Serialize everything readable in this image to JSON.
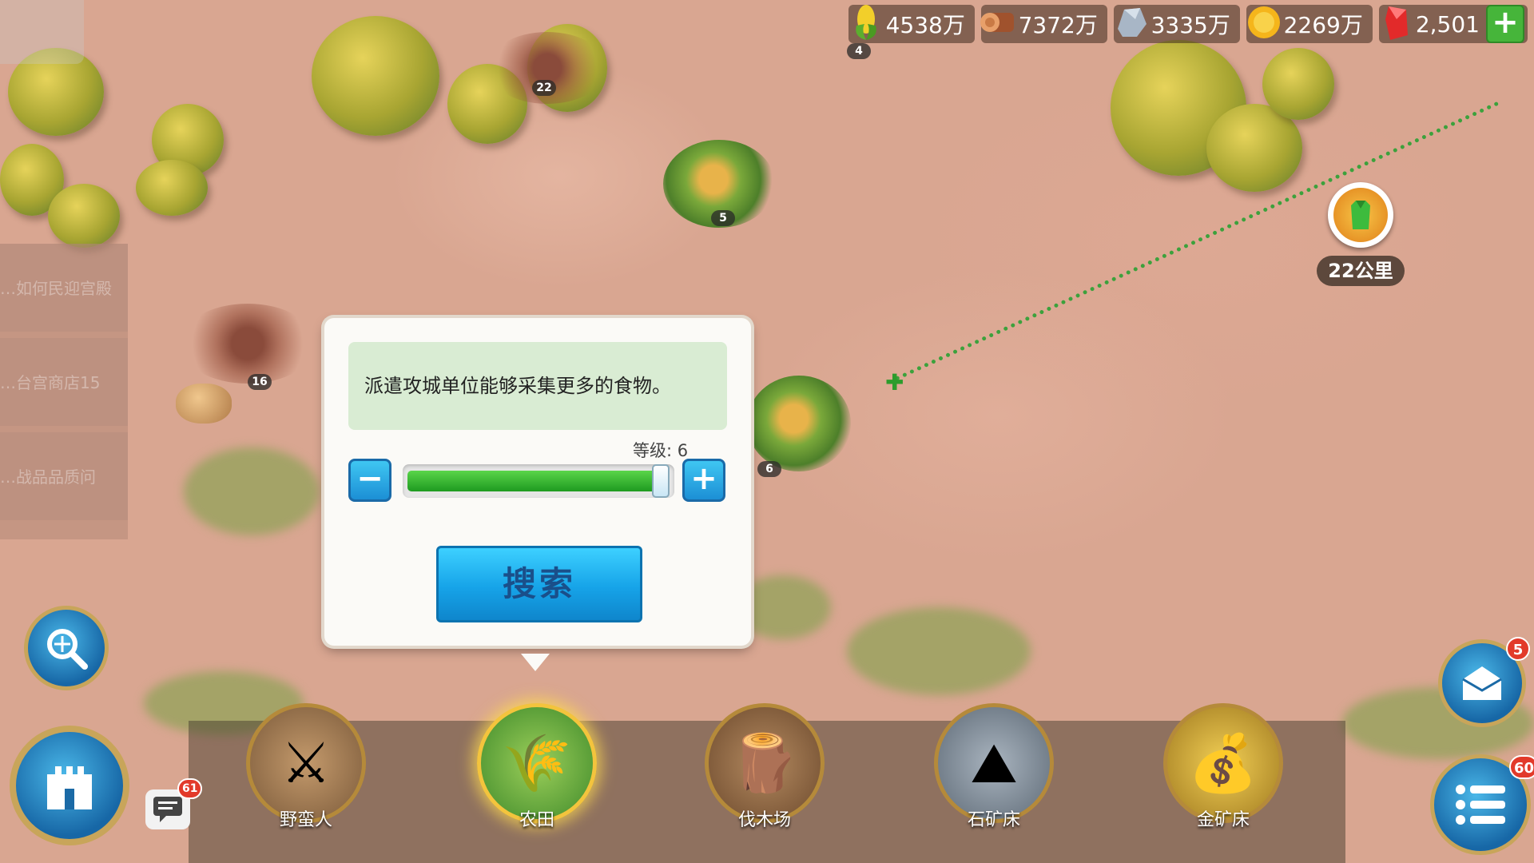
{
  "resources": {
    "food": "4538万",
    "wood": "7372万",
    "stone": "3335万",
    "gold": "2269万",
    "gems": "2,501"
  },
  "map": {
    "node_levels": [
      "4",
      "22",
      "5",
      "16",
      "6"
    ],
    "distance": "22公里"
  },
  "quests": [
    "…如何民迎宫殿",
    "…台宫商店15",
    "…战品品质问"
  ],
  "search_dialog": {
    "hint": "派遣攻城单位能够采集更多的食物。",
    "level_label": "等级: 6",
    "level": 6,
    "level_max": 6,
    "minus_label": "−",
    "plus_label": "+",
    "search_button": "搜索"
  },
  "categories": [
    {
      "label": "野蛮人",
      "icon": "barbarian-icon"
    },
    {
      "label": "农田",
      "icon": "farm-icon",
      "selected": true
    },
    {
      "label": "伐木场",
      "icon": "lumber-camp-icon"
    },
    {
      "label": "石矿床",
      "icon": "stone-deposit-icon"
    },
    {
      "label": "金矿床",
      "icon": "gold-deposit-icon"
    }
  ],
  "badges": {
    "chat": "61",
    "mail": "5",
    "menu": "60"
  },
  "colors": {
    "route": "#3ca13c",
    "accent_blue": "#16a3e8",
    "progress_green": "#1e9a20",
    "badge_red": "#e23a2a"
  }
}
